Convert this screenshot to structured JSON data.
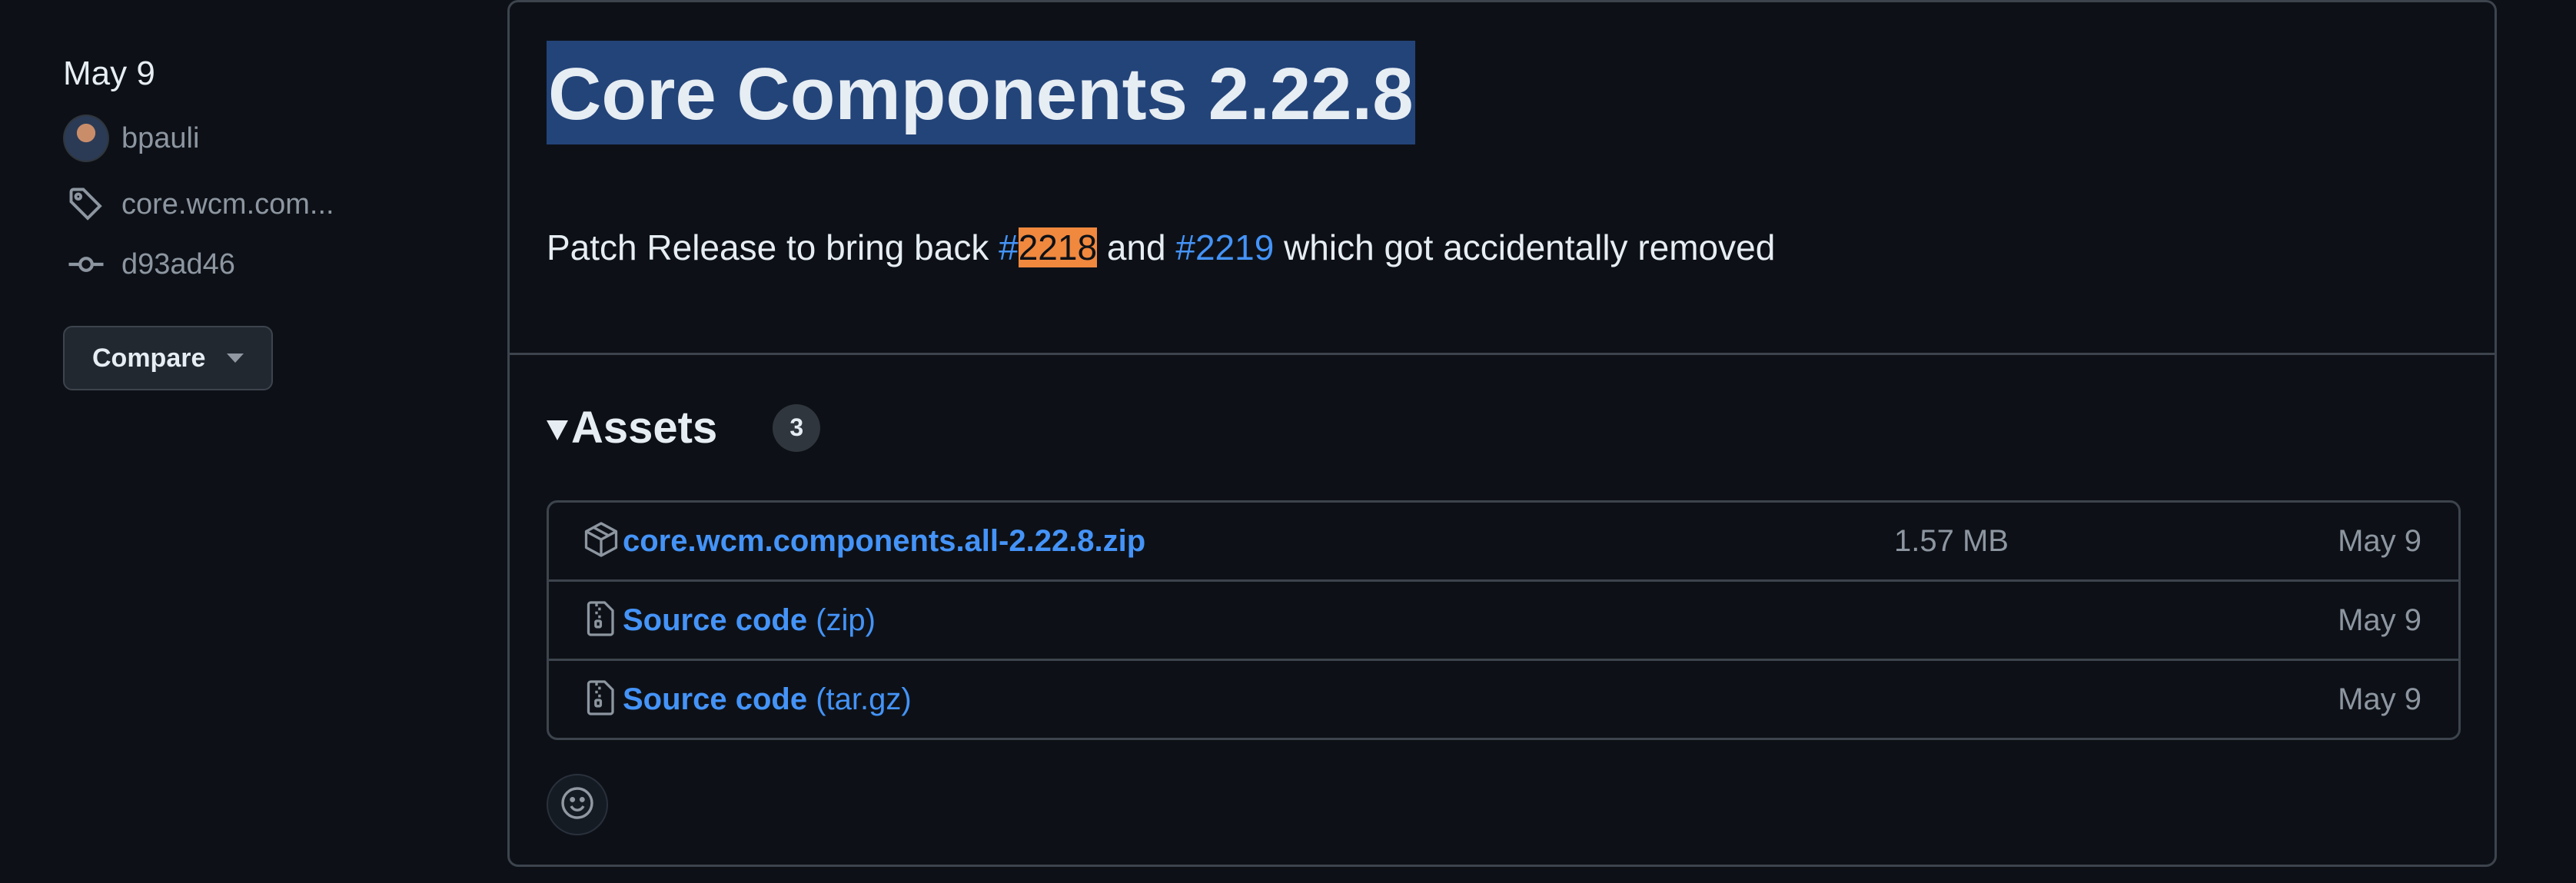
{
  "sidebar": {
    "date": "May 9",
    "author": "bpauli",
    "tag": "core.wcm.com...",
    "commit": "d93ad46",
    "compare_label": "Compare"
  },
  "release": {
    "title": "Core Components 2.22.8",
    "description": {
      "prefix": "Patch Release to bring back ",
      "issue1_hash": "#",
      "issue1_num": "2218",
      "middle": " and ",
      "issue2": "#2219",
      "suffix": " which got accidentally removed"
    }
  },
  "assets": {
    "title": "Assets",
    "count": "3",
    "items": [
      {
        "name": "core.wcm.components.all-2.22.8.zip",
        "suffix": "",
        "size": "1.57 MB",
        "date": "May 9",
        "icon": "package-icon"
      },
      {
        "name": "Source code",
        "suffix": " (zip)",
        "size": "",
        "date": "May 9",
        "icon": "file-zip-icon"
      },
      {
        "name": "Source code",
        "suffix": " (tar.gz)",
        "size": "",
        "date": "May 9",
        "icon": "file-zip-icon"
      }
    ]
  },
  "colors": {
    "background": "#0d1117",
    "link": "#4493f8",
    "title_highlight": "#234479",
    "search_highlight": "#f0883e",
    "border": "#3d444d",
    "muted": "#8d96a0"
  }
}
